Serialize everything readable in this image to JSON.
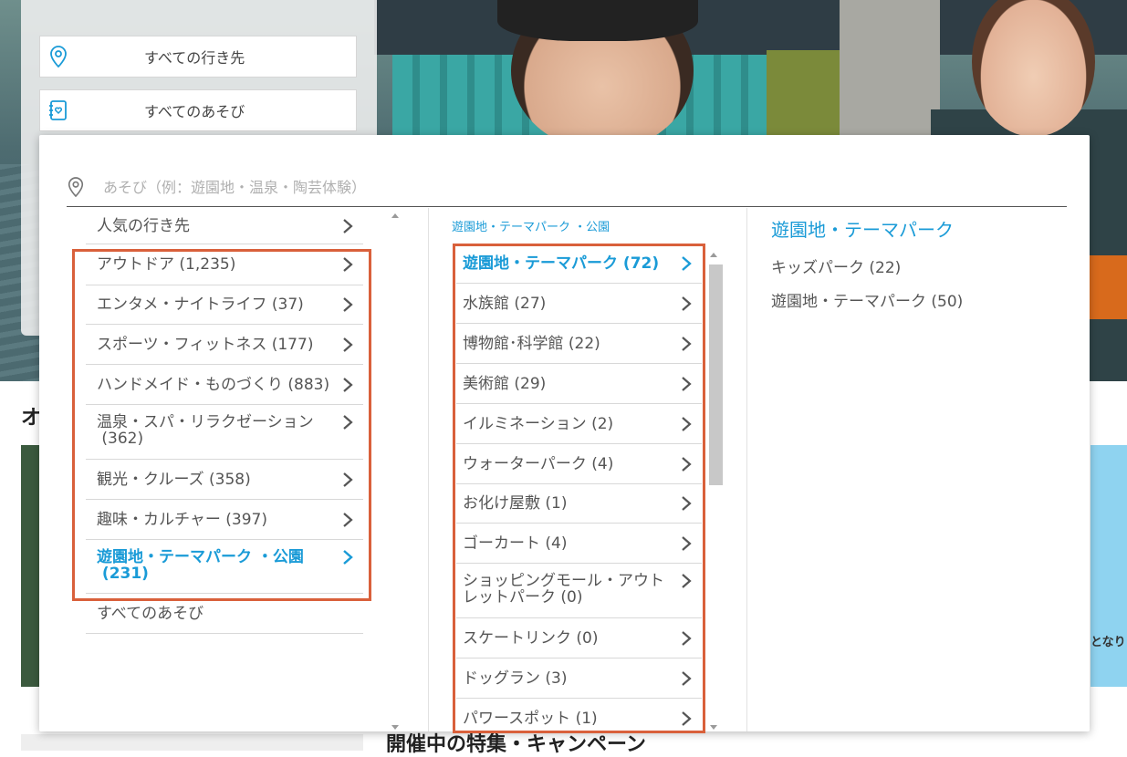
{
  "colors": {
    "accent": "#1a9bd7",
    "highlight": "#d9603b",
    "text": "#555555"
  },
  "search_panel": {
    "destination": {
      "icon": "map-pin-icon",
      "label": "すべての行き先"
    },
    "activity": {
      "icon": "book-heart-icon",
      "label": "すべてのあそび"
    }
  },
  "background": {
    "section_heading": "オ",
    "campaign_heading": "開催中の特集・キャンペーン",
    "right_card_text": "となり"
  },
  "dropdown": {
    "search": {
      "icon": "map-pin-icon",
      "placeholder": "あそび（例：遊園地・温泉・陶芸体験）"
    },
    "categories": [
      {
        "label": "人気の行き先",
        "count": ""
      },
      {
        "label": "アウトドア",
        "count": "(1,235)"
      },
      {
        "label": "エンタメ・ナイトライフ",
        "count": "(37)"
      },
      {
        "label": "スポーツ・フィットネス",
        "count": "(177)"
      },
      {
        "label": "ハンドメイド・ものづくり",
        "count": "(883)"
      },
      {
        "label": "温泉・スパ・リラクゼーション",
        "count": "(362)"
      },
      {
        "label": "観光・クルーズ",
        "count": "(358)"
      },
      {
        "label": "趣味・カルチャー",
        "count": "(397)"
      },
      {
        "label": "遊園地・テーマパーク ・公園",
        "count": "(231)"
      }
    ],
    "all_activities": "すべてのあそび",
    "subcategory_title": "遊園地・テーマパーク ・公園",
    "subcategories": [
      {
        "label": "遊園地・テーマパーク",
        "count": "(72)"
      },
      {
        "label": "水族館",
        "count": "(27)"
      },
      {
        "label": "博物館･科学館",
        "count": "(22)"
      },
      {
        "label": "美術館",
        "count": "(29)"
      },
      {
        "label": "イルミネーション",
        "count": "(2)"
      },
      {
        "label": "ウォーターパーク",
        "count": "(4)"
      },
      {
        "label": "お化け屋敷",
        "count": "(1)"
      },
      {
        "label": "ゴーカート",
        "count": "(4)"
      },
      {
        "label": "ショッピングモール・アウトレットパーク",
        "count": "(0)"
      },
      {
        "label": "スケートリンク",
        "count": "(0)"
      },
      {
        "label": "ドッグラン",
        "count": "(3)"
      },
      {
        "label": "パワースポット",
        "count": "(1)"
      }
    ],
    "detail_title": "遊園地・テーマパーク",
    "details": [
      {
        "label": "キッズパーク",
        "count": "(22)"
      },
      {
        "label": "遊園地・テーマパーク",
        "count": "(50)"
      }
    ]
  }
}
